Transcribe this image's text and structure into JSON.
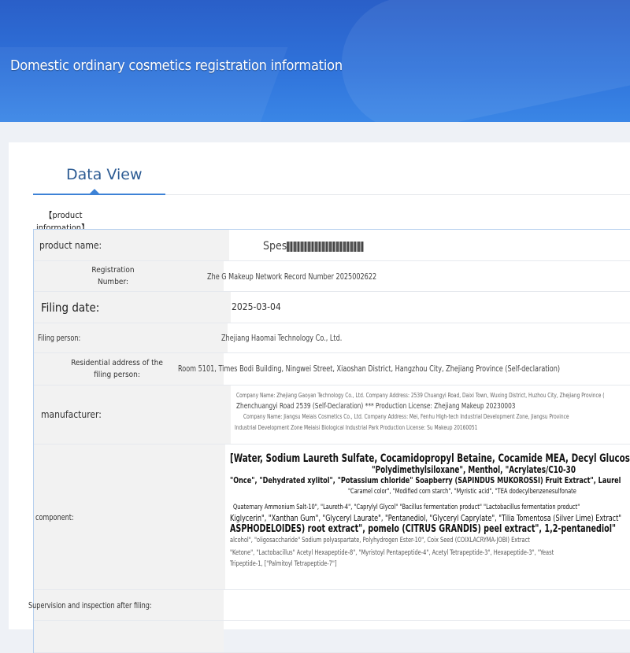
{
  "banner": {
    "title": "Domestic ordinary cosmetics registration information"
  },
  "tabs": {
    "active": "Data View"
  },
  "section": {
    "label": "【product information】"
  },
  "rows": {
    "product_name": {
      "label": "product name:",
      "value_prefix": "Spes"
    },
    "registration_number": {
      "label": "Registration Number:",
      "value": "Zhe G Makeup Network Record Number 2025002622"
    },
    "filing_date": {
      "label": "Filing date:",
      "value": "2025-03-04"
    },
    "filing_person": {
      "label": "Filing person:",
      "value": "Zhejiang Haomai Technology Co., Ltd."
    },
    "residential_address": {
      "label": "Residential address of the filing person:",
      "value": "Room 5101, Times Bodi Building, Ningwei Street, Xiaoshan District, Hangzhou City, Zhejiang Province (Self-declaration)"
    },
    "manufacturer": {
      "label": "manufacturer:",
      "line1": "Company Name: Zhejiang Gaoyan Technology Co., Ltd. Company Address: 2539 Chuangyi Road, Daixi Town, Wuxing District, Huzhou City, Zhejiang Province (",
      "line2": "Zhenchuangyi Road 2539 (Self-Declaration) *** Production License: Zhejiang Makeup 20230003",
      "line3": "Company Name: Jiangsu Meiais Cosmetics Co., Ltd. Company Address: Mei, Fenhu High-tech Industrial Development Zone, Jiangsu Province",
      "line4": "Industrial Development Zone Meiaisi Biological Industrial Park Production License: Su Makeup 20160051"
    },
    "component": {
      "label": "component:",
      "line1": "[Water, Sodium Laureth Sulfate, Cocamidopropyl Betaine, Cocamide MEA, Decyl Glucosid",
      "line2": "\"Polydimethylsiloxane\", Menthol, \"Acrylates/C10-30",
      "line3": "\"Once\", \"Dehydrated xylitol\", \"Potassium chloride\" Soapberry (SAPINDUS MUKOROSSI) Fruit Extract\", Laurel",
      "line4": "\"Caramel color\", \"Modified corn starch\", \"Myristic acid\", \"TEA dodecylbenzenesulfonate",
      "line5": "Quaternary Ammonium Salt-10\", \"Laureth-4\", \"Caprylyl Glycol\" \"Bacillus fermentation product\" \"Lactobacillus fermentation product\"",
      "line6": "Kiglycerin\", \"Xanthan Gum\", \"Glyceryl Laurate\", \"Pentanediol, \"Glyceryl Caprylate\", \"Tilia Tomentosa (Silver Lime) Extract\"",
      "line7": "ASPHODELOIDES) root extract\", pomelo (CITRUS GRANDIS) peel extract\", 1,2-pentanediol\"",
      "line8": "alcohol\", \"oligosaccharide\" Sodium polyaspartate, Polyhydrogen Ester-10\", Coix Seed (COIXLACRYMA-JOBI) Extract",
      "line9": "\"Ketone\", \"Lactobacillus\" Acetyl Hexapeptide-8\", \"Myristoyl Pentapeptide-4\", Acetyl Tetrapeptide-3\", Hexapeptide-3\", \"Yeast",
      "line10": "Tripeptide-1, [\"Palmitoyl Tetrapeptide-7\"]"
    },
    "supervision": {
      "label": "Supervision and inspection after filing:",
      "value": ""
    }
  }
}
